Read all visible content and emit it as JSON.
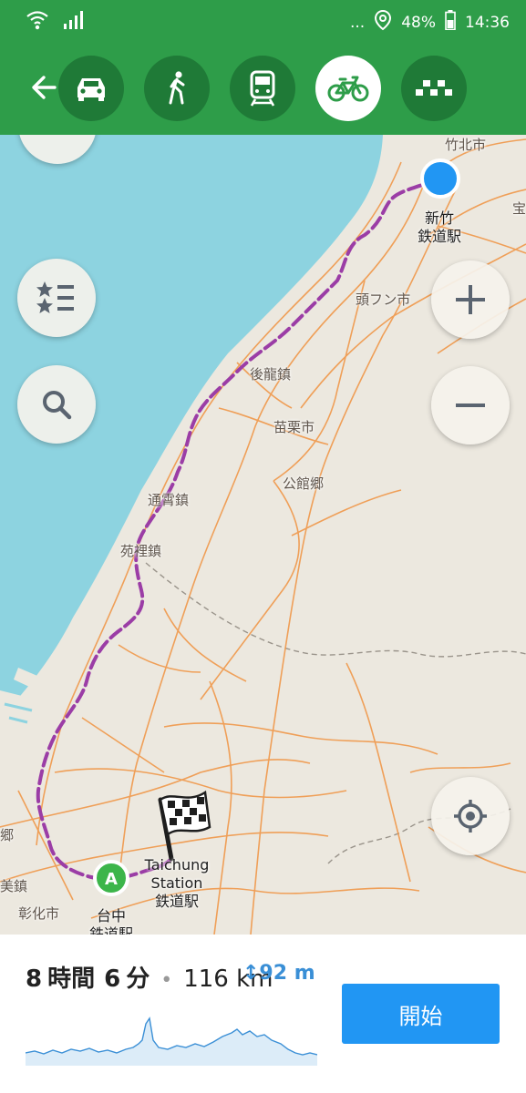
{
  "status_bar": {
    "dots": "...",
    "battery": "48%",
    "time": "14:36"
  },
  "route_modes": [
    {
      "name": "car",
      "icon": "car-icon",
      "active": false
    },
    {
      "name": "walk",
      "icon": "pedestrian-icon",
      "active": false
    },
    {
      "name": "transit",
      "icon": "train-icon",
      "active": false
    },
    {
      "name": "bicycle",
      "icon": "bicycle-icon",
      "active": true
    },
    {
      "name": "taxi",
      "icon": "taxi-icon",
      "active": false
    }
  ],
  "map": {
    "places": {
      "zhubei": "竹北市",
      "hsinchu_station_1": "新竹",
      "hsinchu_station_2": "鉄道駅",
      "toufen": "頭フン市",
      "houlong": "後龍鎮",
      "miaoli": "苗栗市",
      "gongguan": "公館郷",
      "tongxiao": "通霄鎮",
      "yuanli": "苑裡鎮",
      "taichung_1": "Taichung",
      "taichung_2": "Station",
      "taichung_3": "鉄道駅",
      "taichung_city_1": "台中",
      "taichung_city_2": "鉄道駅",
      "changhua": "彰化市",
      "edge_left_1": "郷",
      "edge_left_2": "美鎮",
      "edge_right": "宝"
    },
    "start_marker_label": "A",
    "colors": {
      "sea": "#8dd3e0",
      "land": "#ece8df",
      "roads": "#f0984a",
      "route": "#9b3da6",
      "current_location": "#2196f3",
      "start_marker": "#3cb54a"
    }
  },
  "map_controls": {
    "bookmarks": "bookmarks-icon",
    "search": "search-icon",
    "zoom_in": "plus-icon",
    "zoom_out": "minus-icon",
    "my_location": "locate-icon"
  },
  "route_summary": {
    "time_hours": "8",
    "time_hours_unit": "時間",
    "time_minutes": "6",
    "time_minutes_unit": "分",
    "separator": "•",
    "distance": "116 km",
    "climb": "↕92 m",
    "start_button": "開始"
  }
}
